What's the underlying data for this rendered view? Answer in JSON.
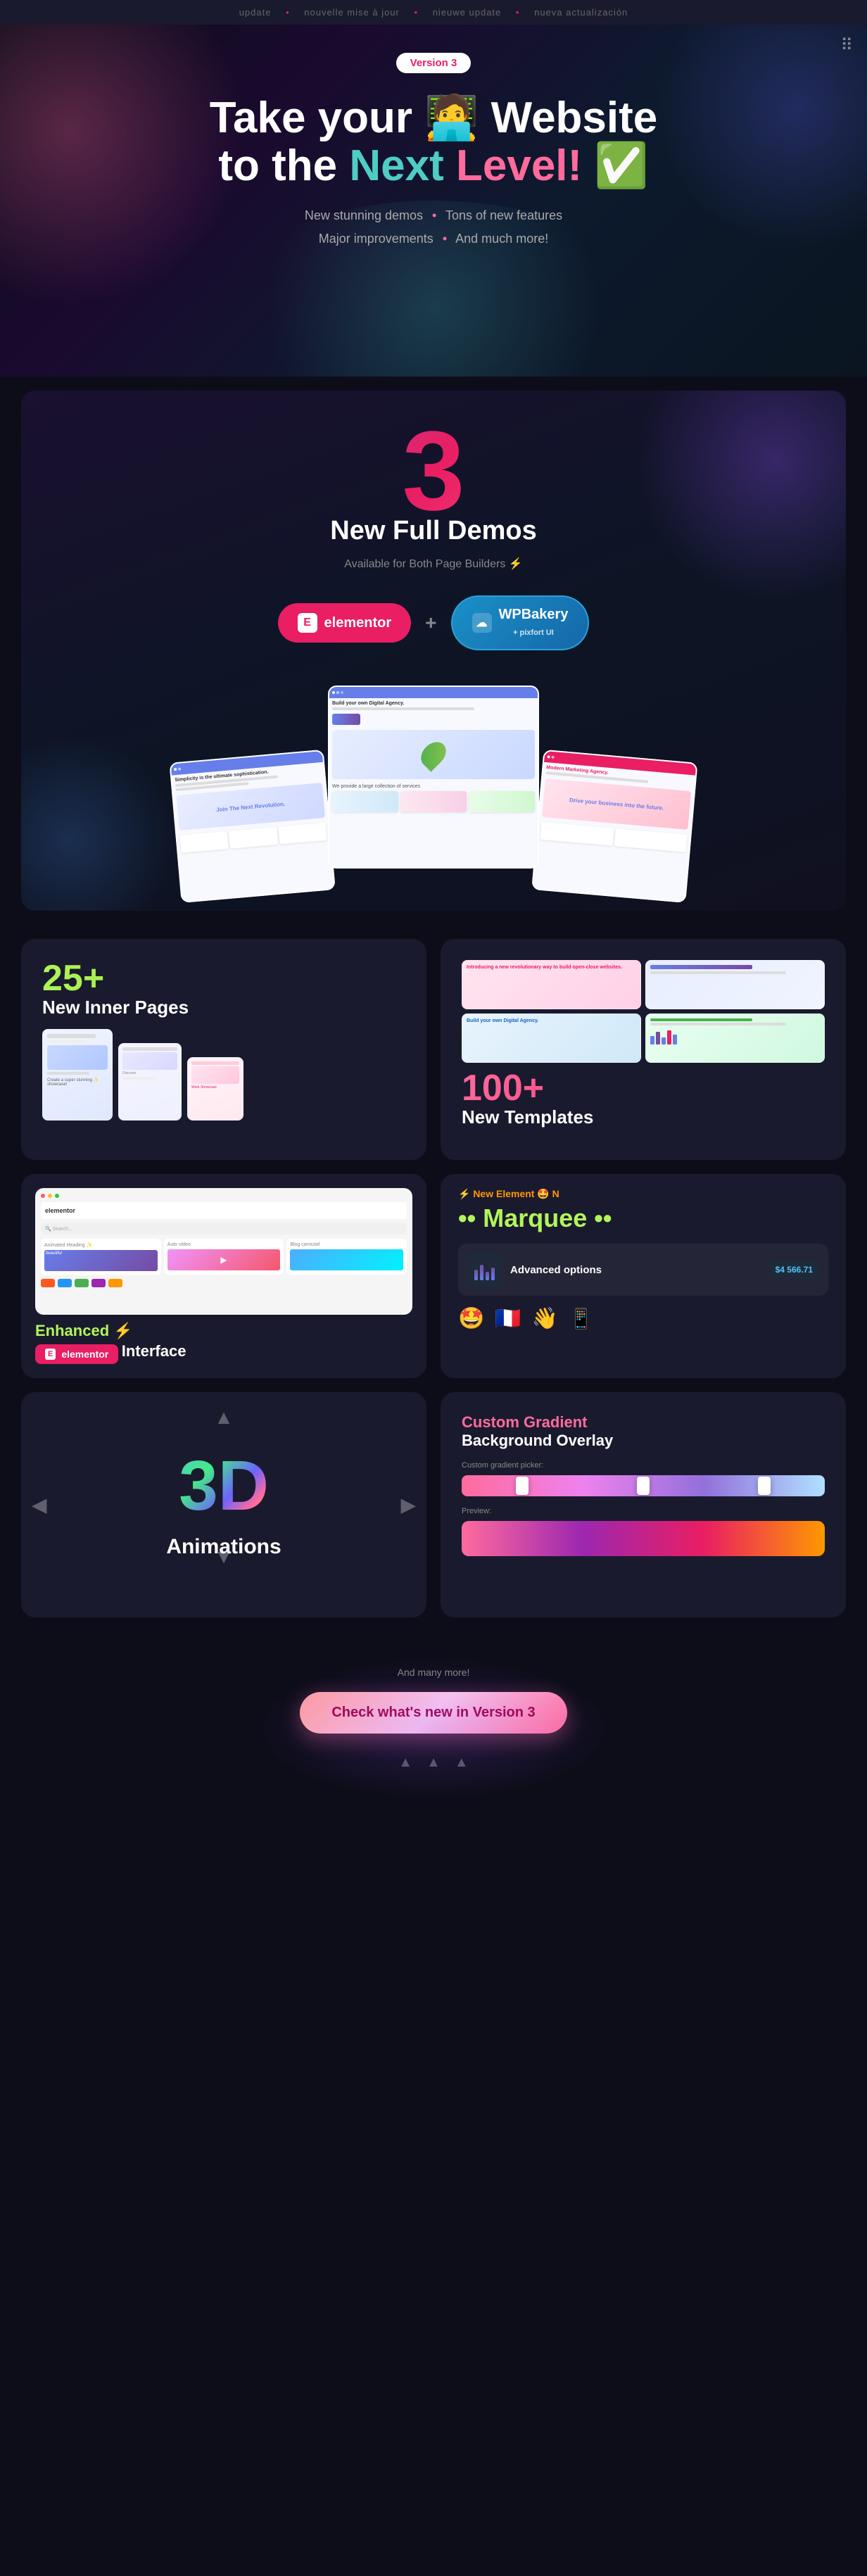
{
  "ticker": {
    "items": [
      "update",
      "nouvelle mise à jour",
      "nieuwe update",
      "nueva actualización"
    ],
    "dots": [
      "•",
      "•",
      "•",
      "•"
    ]
  },
  "top_icon": "⠿",
  "version_badge": "Version 3",
  "hero": {
    "title_line1": "Take your 🧑‍💻 Website",
    "title_line2_before": "to the ",
    "title_highlight1": "Next",
    "title_line2_mid": " ",
    "title_highlight2": "Level!",
    "title_emoji": "✅",
    "features": [
      "New stunning demos",
      "Tons of new features",
      "Major improvements",
      "And much more!"
    ],
    "bullet": "•"
  },
  "demos": {
    "number": "3",
    "title": "New Full Demos",
    "subtitle": "Available for Both Page Builders ⚡",
    "elementor_label": "elementor",
    "wpbakery_label": "WPBakery",
    "pixfort_label": "+ pixfort UI",
    "plus": "+"
  },
  "features": {
    "inner_pages": {
      "number": "25+",
      "title": "New Inner Pages"
    },
    "templates": {
      "number": "100+",
      "title": "New Templates"
    }
  },
  "elementor_section": {
    "elementor_nav": "elementor",
    "animated_heading_label": "Animated Heading ✨",
    "animated_heading_sub": "beautiful",
    "auto_video_label": "Auto video",
    "blog_carousel_label": "Blog carousel",
    "enhanced_label": "Enhanced ⚡",
    "elementor_badge": "elementor",
    "interface_label": "Interface"
  },
  "marquee_section": {
    "header": "⚡ New Element 🤩 N",
    "marquee_text": "•• Marquee ••",
    "advanced_label": "Advanced options",
    "price": "$4 566.71",
    "emojis": [
      "🤩",
      "🇫🇷",
      "👋"
    ],
    "phone_emoji": "📱"
  },
  "animations_3d": {
    "text": "3D",
    "label": "Animations"
  },
  "gradient": {
    "title_pink": "Custom Gradient",
    "title_white": "Background Overlay",
    "picker_label": "Custom gradient picker:",
    "preview_label": "Preview:"
  },
  "cta": {
    "and_many_more": "And many more!",
    "button_label": "Check what's new in Version 3"
  }
}
